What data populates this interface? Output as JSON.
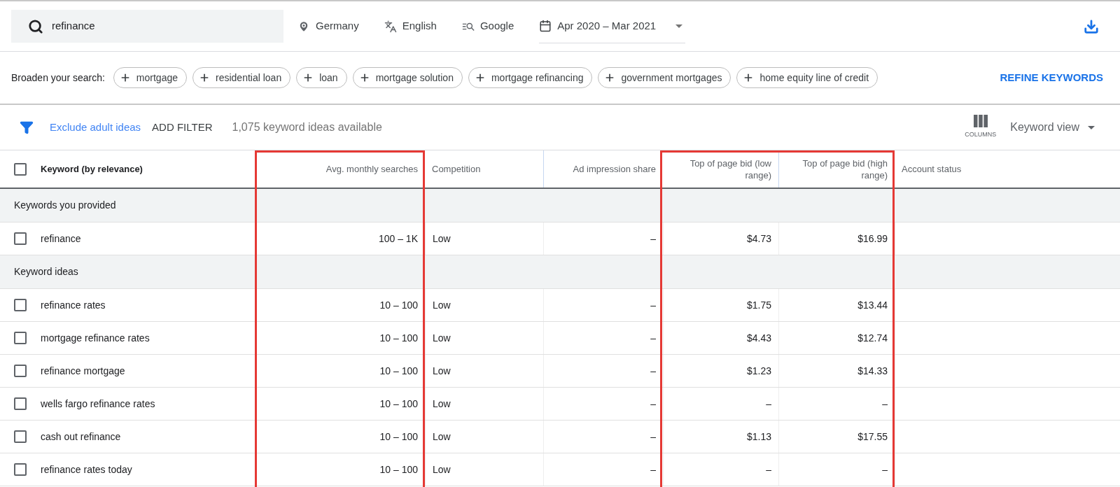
{
  "search": {
    "value": "refinance"
  },
  "targeting": [
    {
      "kind": "location",
      "label": "Germany"
    },
    {
      "kind": "language",
      "label": "English"
    },
    {
      "kind": "network",
      "label": "Google"
    }
  ],
  "date_range": {
    "label": "Apr 2020 – Mar 2021"
  },
  "broaden": {
    "label": "Broaden your search:",
    "chips": [
      "mortgage",
      "residential loan",
      "loan",
      "mortgage solution",
      "mortgage refinancing",
      "government mortgages",
      "home equity line of credit"
    ],
    "action": "REFINE KEYWORDS"
  },
  "toolbar": {
    "exclude_link": "Exclude adult ideas",
    "add_filter": "ADD FILTER",
    "count": "1,075 keyword ideas available",
    "columns_label": "COLUMNS",
    "view": "Keyword view"
  },
  "table": {
    "select_all": {
      "checked": false
    },
    "columns": [
      {
        "label": "Keyword (by relevance)",
        "kind": "text",
        "highlighted": false
      },
      {
        "label": "Avg. monthly searches",
        "kind": "number",
        "highlighted": true
      },
      {
        "label": "Competition",
        "kind": "text",
        "highlighted": false
      },
      {
        "label": "Ad impression share",
        "kind": "number",
        "highlighted": false
      },
      {
        "label": "Top of page bid (low range)",
        "kind": "number",
        "highlighted": true
      },
      {
        "label": "Top of page bid (high range)",
        "kind": "number",
        "highlighted": true
      },
      {
        "label": "Account status",
        "kind": "text",
        "highlighted": false
      }
    ],
    "rows": [
      {
        "kind": "group",
        "label": "Keywords you provided"
      },
      {
        "kind": "keyword",
        "checked": false,
        "cells": [
          "refinance",
          "100 – 1K",
          "Low",
          "–",
          "$4.73",
          "$16.99"
        ]
      },
      {
        "kind": "group",
        "label": "Keyword ideas"
      },
      {
        "kind": "keyword",
        "checked": false,
        "cells": [
          "refinance rates",
          "10 – 100",
          "Low",
          "–",
          "$1.75",
          "$13.44"
        ]
      },
      {
        "kind": "keyword",
        "checked": false,
        "cells": [
          "mortgage refinance rates",
          "10 – 100",
          "Low",
          "–",
          "$4.43",
          "$12.74"
        ]
      },
      {
        "kind": "keyword",
        "checked": false,
        "cells": [
          "refinance mortgage",
          "10 – 100",
          "Low",
          "–",
          "$1.23",
          "$14.33"
        ]
      },
      {
        "kind": "keyword",
        "checked": false,
        "cells": [
          "wells fargo refinance rates",
          "10 – 100",
          "Low",
          "–",
          "–",
          "–"
        ]
      },
      {
        "kind": "keyword",
        "checked": false,
        "cells": [
          "cash out refinance",
          "10 – 100",
          "Low",
          "–",
          "$1.13",
          "$17.55"
        ]
      },
      {
        "kind": "keyword",
        "checked": false,
        "cells": [
          "refinance rates today",
          "10 – 100",
          "Low",
          "–",
          "–",
          "–"
        ]
      }
    ]
  }
}
